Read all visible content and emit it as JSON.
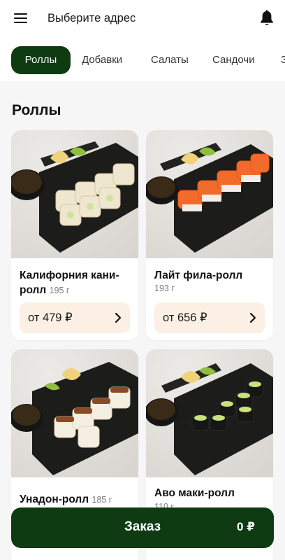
{
  "header": {
    "address_label": "Выберите адрес",
    "icons": [
      "hamburger-menu-icon",
      "bell-icon"
    ]
  },
  "tabs": [
    {
      "label": "Роллы",
      "active": true
    },
    {
      "label": "Добавки",
      "active": false
    },
    {
      "label": "Салаты",
      "active": false
    },
    {
      "label": "Сандочи",
      "active": false
    }
  ],
  "section": {
    "title": "Роллы"
  },
  "products": [
    {
      "name": "Калифорния кани-ролл",
      "weight": "195 г",
      "price": "от 479 ₽"
    },
    {
      "name": "Лайт фила-ролл",
      "weight": "193 г",
      "price": "от 656 ₽"
    },
    {
      "name": "Унадон-ролл",
      "weight": "185 г"
    },
    {
      "name": "Аво маки-ролл",
      "weight": "110 г"
    }
  ],
  "order": {
    "label": "Заказ",
    "total": "0 ₽"
  },
  "colors": {
    "accent": "#0e3b12",
    "price_bg": "#fbf0e3",
    "page_bg": "#f6f6f6",
    "plate": "#1c1c1a"
  }
}
